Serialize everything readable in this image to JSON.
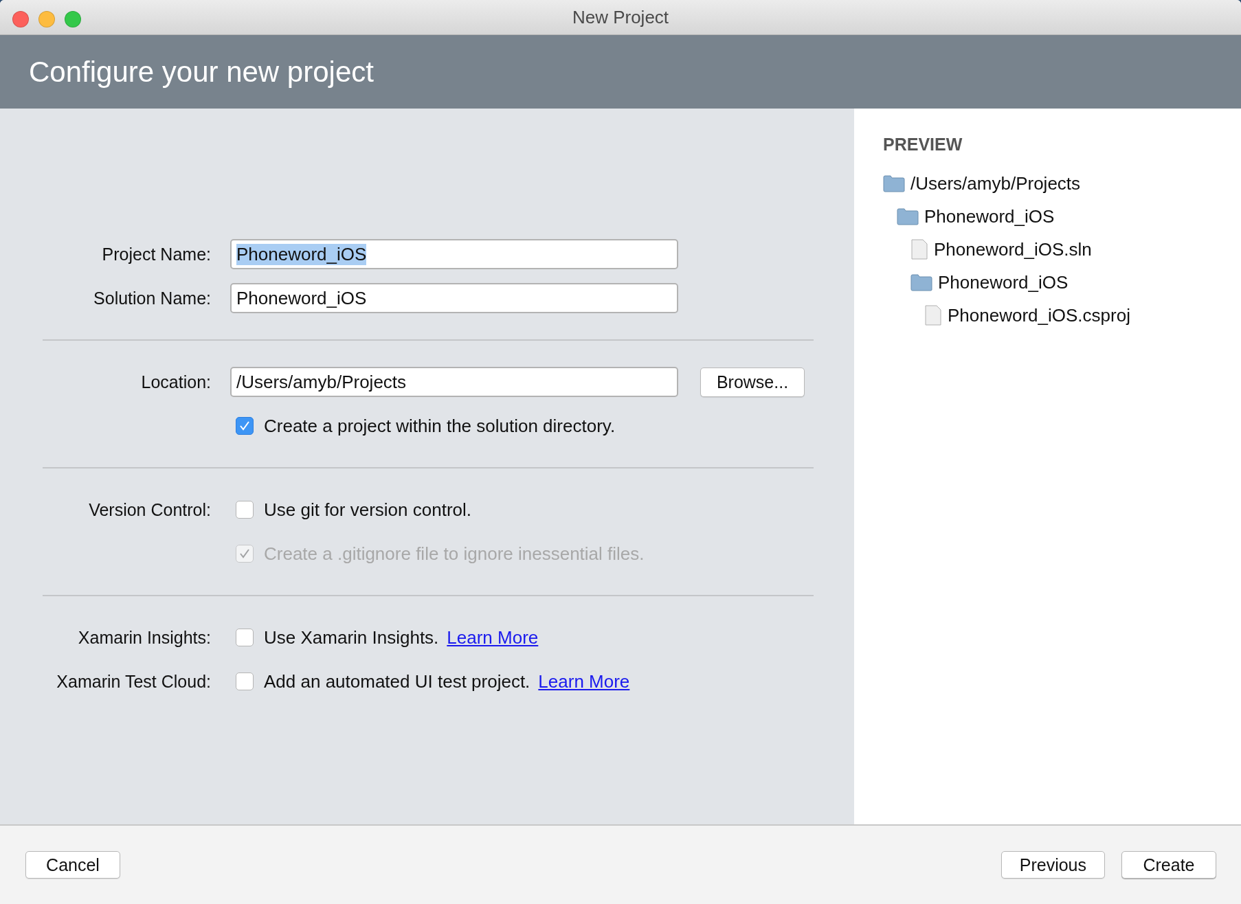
{
  "window": {
    "title": "New Project"
  },
  "header": {
    "title": "Configure your new project"
  },
  "sections": [
    {
      "rows": [
        {
          "kind": "field",
          "label": "Project Name:",
          "value": "Phoneword_iOS",
          "text_selected": true
        },
        {
          "kind": "field",
          "label": "Solution Name:",
          "value": "Phoneword_iOS",
          "text_selected": false
        }
      ]
    },
    {
      "rows": [
        {
          "kind": "field",
          "label": "Location:",
          "value": "/Users/amyb/Projects",
          "text_selected": false,
          "button": "Browse..."
        },
        {
          "kind": "checkbox",
          "text": "Create a project within the solution directory.",
          "checked": true,
          "disabled": false
        }
      ]
    },
    {
      "rows": [
        {
          "kind": "checkbox",
          "label": "Version Control:",
          "text": "Use git for version control.",
          "checked": false,
          "disabled": false
        },
        {
          "kind": "checkbox",
          "text": "Create a .gitignore file to ignore inessential files.",
          "checked": true,
          "disabled": true
        }
      ]
    },
    {
      "rows": [
        {
          "kind": "checkbox",
          "label": "Xamarin Insights:",
          "text": "Use Xamarin Insights.",
          "link": "Learn More",
          "checked": false,
          "disabled": false
        },
        {
          "kind": "checkbox",
          "label": "Xamarin Test Cloud:",
          "text": "Add an automated UI test project.",
          "link": "Learn More",
          "checked": false,
          "disabled": false
        }
      ]
    }
  ],
  "preview": {
    "title": "PREVIEW",
    "tree": [
      {
        "kind": "folder",
        "name": "/Users/amyb/Projects",
        "children": [
          {
            "kind": "folder",
            "name": "Phoneword_iOS",
            "children": [
              {
                "kind": "file",
                "name": "Phoneword_iOS.sln"
              },
              {
                "kind": "folder",
                "name": "Phoneword_iOS",
                "children": [
                  {
                    "kind": "file",
                    "name": "Phoneword_iOS.csproj"
                  }
                ]
              }
            ]
          }
        ]
      }
    ]
  },
  "footer": {
    "left_buttons": [
      "Cancel"
    ],
    "right_buttons": [
      "Previous",
      "Create"
    ]
  }
}
